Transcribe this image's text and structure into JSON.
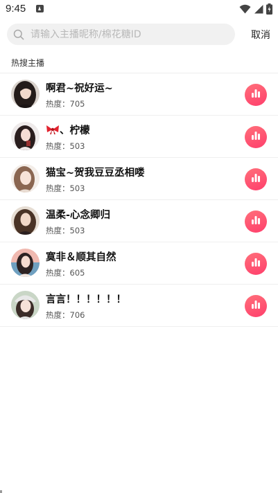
{
  "status_bar": {
    "time": "9:45",
    "icons": [
      "notification-icon",
      "wifi-icon",
      "signal-icon",
      "battery-icon"
    ]
  },
  "search": {
    "placeholder": "请输入主播昵称/棉花糖ID",
    "value": "",
    "cancel_label": "取消"
  },
  "section": {
    "title": "热搜主播"
  },
  "anchors": [
    {
      "name": "啊君~祝好运~",
      "heat_label": "热度：",
      "heat": "705",
      "avatar": "avatar-dark-hair"
    },
    {
      "name": "、柠檬",
      "prefix_icon": "red-bow-icon",
      "heat_label": "热度：",
      "heat": "503",
      "avatar": "avatar-long-hair"
    },
    {
      "name": "猫宝~贺我豆豆丞相喽",
      "heat_label": "热度：",
      "heat": "503",
      "avatar": "avatar-light"
    },
    {
      "name": "温柔-心念卿归",
      "heat_label": "热度：",
      "heat": "503",
      "avatar": "avatar-brown-hair"
    },
    {
      "name": "寞非＆顺其自然",
      "heat_label": "热度：",
      "heat": "605",
      "avatar": "avatar-sunset"
    },
    {
      "name": "言言！！！！！！",
      "heat_label": "热度：",
      "heat": "706",
      "avatar": "avatar-hat"
    }
  ],
  "colors": {
    "accent_gradient_start": "#ff6f7a",
    "accent_gradient_end": "#ff3f6c",
    "search_bg": "#f1f1f1",
    "placeholder": "#b8b8b8"
  }
}
